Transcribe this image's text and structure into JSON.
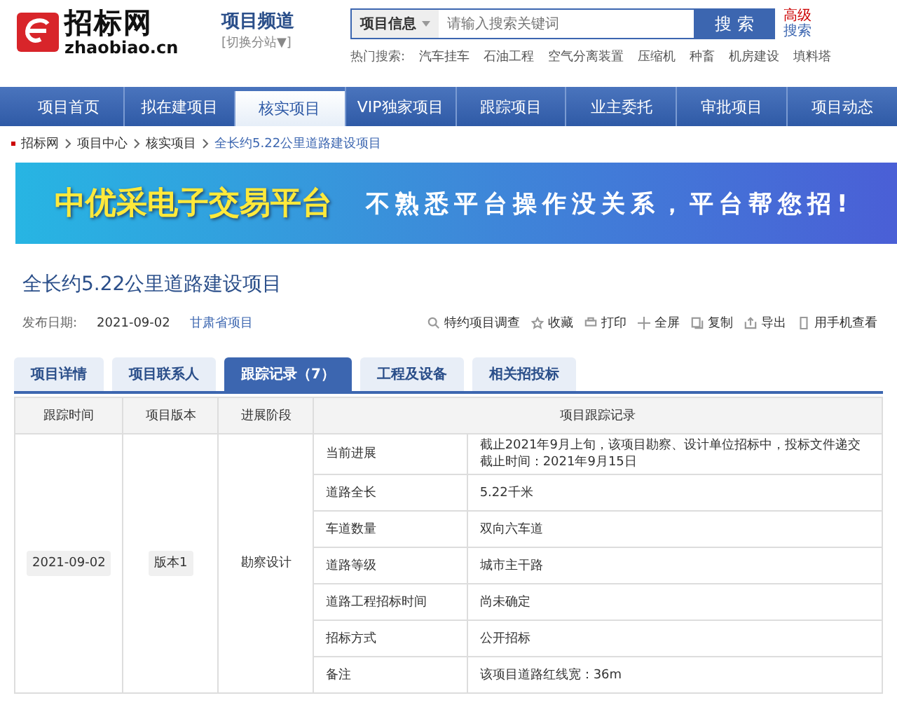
{
  "logo": {
    "name": "招标网",
    "domain": "zhaobiao.cn"
  },
  "channel": {
    "title": "项目频道",
    "switch": "[切换分站▼]"
  },
  "search": {
    "category": "项目信息",
    "placeholder": "请输入搜索关键词",
    "button": "搜 索",
    "advanced": "高级",
    "portal": "搜索"
  },
  "hot": {
    "label": "热门搜索:",
    "terms": [
      "汽车挂车",
      "石油工程",
      "空气分离装置",
      "压缩机",
      "种畜",
      "机房建设",
      "填料塔"
    ]
  },
  "nav": [
    {
      "label": "项目首页",
      "selected": false
    },
    {
      "label": "拟在建项目",
      "selected": false
    },
    {
      "label": "核实项目",
      "selected": true
    },
    {
      "label": "VIP独家项目",
      "selected": false
    },
    {
      "label": "跟踪项目",
      "selected": false
    },
    {
      "label": "业主委托",
      "selected": false
    },
    {
      "label": "审批项目",
      "selected": false
    },
    {
      "label": "项目动态",
      "selected": false
    }
  ],
  "breadcrumb": [
    "招标网",
    "项目中心",
    "核实项目",
    "全长约5.22公里道路建设项目"
  ],
  "banner": {
    "headline": "中优采电子交易平台",
    "slogan": "不熟悉平台操作没关系，平台帮您招!"
  },
  "project": {
    "title": "全长约5.22公里道路建设项目",
    "date_label": "发布日期:",
    "date": "2021-09-02",
    "region": "甘肃省项目"
  },
  "actions": [
    {
      "kind": "search",
      "label": "特约项目调查"
    },
    {
      "kind": "star",
      "label": "收藏"
    },
    {
      "kind": "print",
      "label": "打印"
    },
    {
      "kind": "move",
      "label": "全屏"
    },
    {
      "kind": "copy",
      "label": "复制"
    },
    {
      "kind": "export",
      "label": "导出"
    },
    {
      "kind": "phone",
      "label": "用手机查看"
    }
  ],
  "tabs": [
    {
      "label": "项目详情",
      "selected": false
    },
    {
      "label": "项目联系人",
      "selected": false
    },
    {
      "label": "跟踪记录（7）",
      "selected": true
    },
    {
      "label": "工程及设备",
      "selected": false
    },
    {
      "label": "相关招投标",
      "selected": false
    }
  ],
  "table": {
    "columns": [
      "跟踪时间",
      "项目版本",
      "进展阶段",
      "项目跟踪记录"
    ],
    "entry": {
      "date": "2021-09-02",
      "version": "版本1",
      "stage": "勘察设计"
    },
    "records": [
      {
        "field": "当前进展",
        "value": "截止2021年9月上旬，该项目勘察、设计单位招标中，投标文件递交截止时间：2021年9月15日"
      },
      {
        "field": "道路全长",
        "value": "5.22千米"
      },
      {
        "field": "车道数量",
        "value": "双向六车道"
      },
      {
        "field": "道路等级",
        "value": "城市主干路"
      },
      {
        "field": "道路工程招标时间",
        "value": "尚未确定"
      },
      {
        "field": "招标方式",
        "value": "公开招标"
      },
      {
        "field": "备注",
        "value": "该项目道路红线宽：36m"
      }
    ]
  }
}
